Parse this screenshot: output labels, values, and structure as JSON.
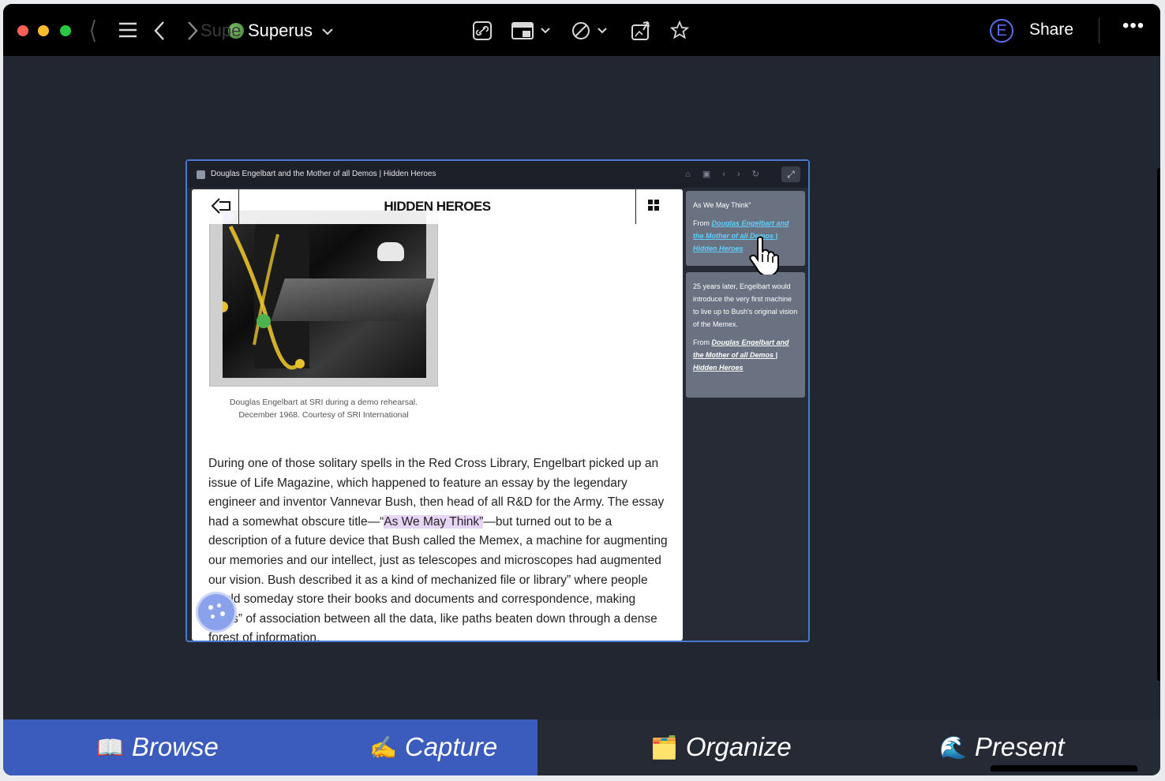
{
  "app": {
    "title": "Superus",
    "ghost_title": "Supe",
    "avatar_letter": "E",
    "share_label": "Share",
    "more_label": "•••"
  },
  "card": {
    "title": "Douglas Engelbart and the Mother of all Demos | Hidden Heroes",
    "tools": "⌂ ▣ ‹ › ↻",
    "expand": "⤢"
  },
  "site": {
    "name": "HIDDEN HEROES",
    "caption_line1": "Douglas Engelbart at SRI during a demo rehearsal.",
    "caption_line2": "December 1968. Courtesy of SRI International"
  },
  "article": {
    "before": "During one of those solitary spells in the Red Cross Library, Engelbart picked up an issue of Life Magazine, which happened to feature an essay by the legendary engineer and inventor Vannevar Bush, then head of all R&D for the Army. The essay had a somewhat obscure title—“",
    "highlight": "As We May Think”",
    "after": "—but turned out to be a description of a future device that Bush called the Memex, a machine for augmenting our memories and our intellect, just as telescopes and microscopes had augmented our vision. Bush described it as a kind of mechanized file or library” where people would someday store their books and documents and correspondence, making “trails” of association between all the data, like paths beaten down through a dense forest of information."
  },
  "notes": [
    {
      "quote": "As We May Think”",
      "from_label": "From",
      "link": "Douglas Engelbart and the Mother of all Demos | Hidden Heroes"
    },
    {
      "quote": "25 years later, Engelbart would introduce the very first machine to live up to Bush's original vision of the Memex.",
      "from_label": "From",
      "link": "Douglas Engelbart and the Mother of all Demos | Hidden Heroes"
    }
  ],
  "bottom_tabs": [
    {
      "label": "Browse",
      "emoji": "📖",
      "active": true
    },
    {
      "label": "Capture",
      "emoji": "✍️",
      "active": true
    },
    {
      "label": "Organize",
      "emoji": "🗂️",
      "active": false
    },
    {
      "label": "Present",
      "emoji": "🌊",
      "active": false
    }
  ],
  "colors": {
    "accent": "#3b5bbd",
    "card_border": "#4a78d0",
    "highlight": "#e6d5f5",
    "note_bg": "#6a7180",
    "link": "#5ed0ff"
  }
}
